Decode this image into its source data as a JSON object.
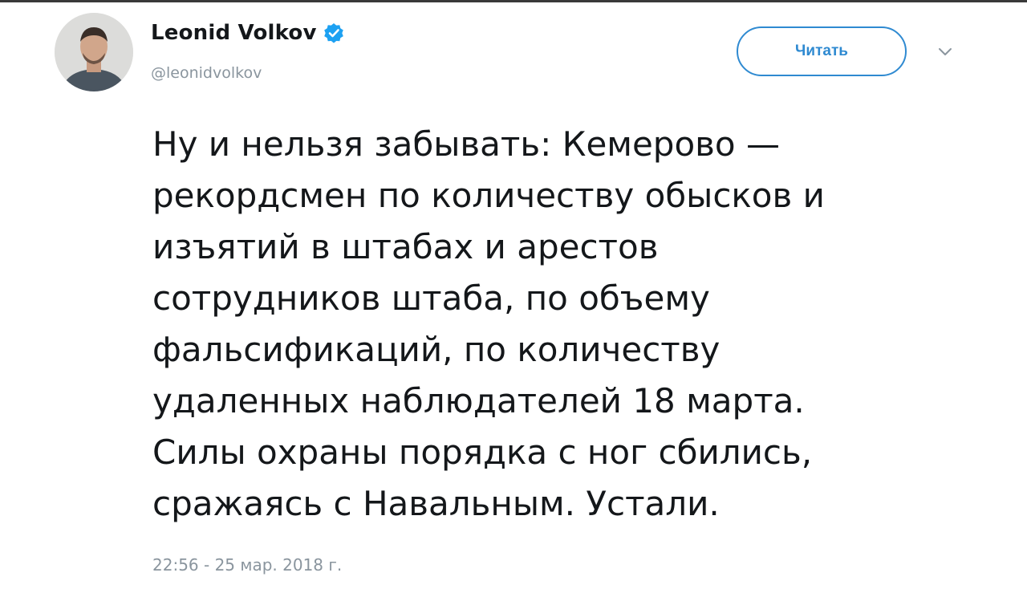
{
  "author": {
    "display_name": "Leonid Volkov",
    "handle": "@leonidvolkov",
    "verified": true,
    "avatar_icon": "user-avatar"
  },
  "actions": {
    "follow_label": "Читать",
    "menu_icon": "chevron-down-icon"
  },
  "tweet": {
    "text": "Ну и нельзя забывать: Кемерово —\nрекордсмен по количеству обысков и\nизъятий в штабах и арестов\nсотрудников штаба, по объему\nфальсификаций, по количеству\nудаленных наблюдателей 18 марта.\nСилы охраны порядка с ног сбились,\nсражаясь с Навальным. Устали.",
    "timestamp": "22:56 - 25 мар. 2018 г."
  },
  "colors": {
    "accent": "#2f8ad1",
    "verified_badge": "#1da1f2",
    "muted_text": "#8a959e"
  }
}
